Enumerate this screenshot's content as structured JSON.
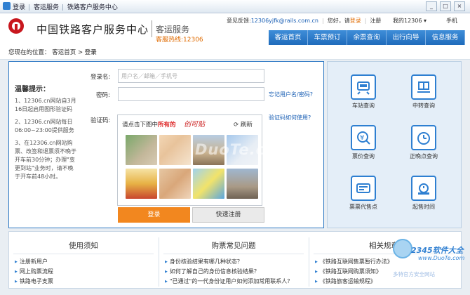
{
  "window": {
    "tabs": [
      "登录",
      "客运服务",
      "铁路客户服务中心"
    ],
    "controls": [
      "_",
      "□",
      "×"
    ]
  },
  "header": {
    "site_name": "中国铁路客户服务中心",
    "sub_title": "客运服务",
    "hotline": "客服热线:12306",
    "feedback_label": "意见反馈:",
    "feedback_email": "12306yjfk@rails.com.cn",
    "greeting": "您好，请",
    "login_link": "登录",
    "register_link": "注册",
    "my_link": "我的12306 ▾",
    "phone_link": "手机"
  },
  "nav": [
    "客运首页",
    "车票预订",
    "余票查询",
    "出行向导",
    "信息服务"
  ],
  "breadcrumb": {
    "prefix": "您现在的位置：",
    "home": "客运首页",
    "sep": ">",
    "current": "登录"
  },
  "tips": {
    "title": "温馨提示：",
    "items": [
      "1、12306.cn网站自3月16日起启用图形验证码",
      "2、12306.cn网站每日06:00~23:00提供服务",
      "3、在12306.cn网站购票、改签和退票须不晚于开车前30分钟；办理\"变更到站\"业务时，请不晚于开车前48小时。"
    ]
  },
  "login": {
    "username_label": "登录名:",
    "username_placeholder": "用户名／邮箱／手机号",
    "password_label": "密码:",
    "forgot_link": "忘记用户名/密码?",
    "captcha_label": "验证码:",
    "captcha_help": "验证码如何使用?",
    "captcha_prompt_pre": "请点击下图中",
    "captcha_prompt_red": "所有的",
    "captcha_target": "创可贴",
    "refresh": "刷新",
    "login_button": "登录",
    "register_button": "快速注册",
    "watermark": "DuoTe.com"
  },
  "services": [
    {
      "label": "车站查询",
      "icon": "station-icon"
    },
    {
      "label": "中转查询",
      "icon": "transfer-icon"
    },
    {
      "label": "票价查询",
      "icon": "price-icon"
    },
    {
      "label": "正晚点查询",
      "icon": "clock-icon"
    },
    {
      "label": "票票代售点",
      "icon": "ticket-icon"
    },
    {
      "label": "起售时间",
      "icon": "alarm-icon"
    }
  ],
  "bottom": {
    "columns": [
      {
        "title": "使用须知",
        "items": [
          "注册新用户",
          "网上购票流程",
          "铁路电子支票"
        ]
      },
      {
        "title": "购票常见问题",
        "items": [
          "身份核验结果有哪几种状态？",
          "如何了解自己的身份信息核验结果？",
          "\"已通过\"的一代身份证用户如何添加常用联系人？"
        ]
      },
      {
        "title": "相关规章",
        "items": [
          "《铁路互联网售票暂行办法》",
          "《铁路互联网购票须知》",
          "《铁路旅客运输规程》"
        ]
      }
    ]
  },
  "branding": {
    "mark": "2345软件大全",
    "url": "www.DuoTe.com",
    "sub": "多特官方安全网站"
  },
  "colors": {
    "brand_red": "#c8171e",
    "nav_blue": "#2e7fd1",
    "login_orange": "#f2871f",
    "hotline_orange": "#e06b00"
  }
}
